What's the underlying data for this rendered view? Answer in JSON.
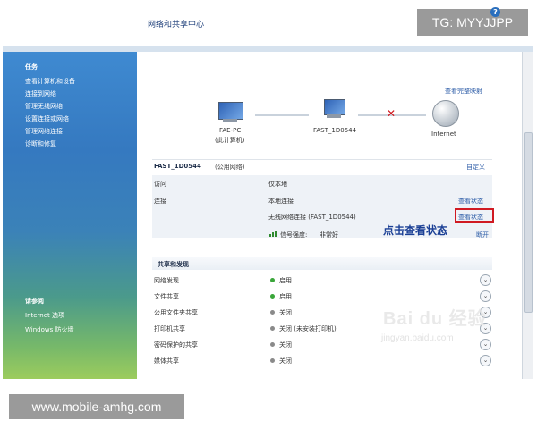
{
  "watermarks": {
    "top": "TG: MYYJJPP",
    "bottom": "www.mobile-amhg.com",
    "baidu": "Bai du 经验",
    "baidu_sub": "jingyan.baidu.com"
  },
  "window": {
    "title": "网络和共享中心"
  },
  "sidebar": {
    "tasks_heading": "任务",
    "items": [
      "查看计算机和设备",
      "连接到网络",
      "管理无线网络",
      "设置连接或网络",
      "管理网络连接",
      "诊断和修复"
    ],
    "see_also_heading": "请参阅",
    "see_also": [
      "Internet 选项",
      "Windows 防火墙"
    ]
  },
  "topology": {
    "view_full_map": "查看完整映射",
    "pc_name": "FAE-PC",
    "pc_caption": "(此计算机)",
    "router_name": "FAST_1D0544",
    "internet": "Internet"
  },
  "network": {
    "name": "FAST_1D0544",
    "type": "(公用网络)",
    "customize": "自定义",
    "access_label": "访问",
    "access_value": "仅本地",
    "connection_label": "连接",
    "connection_local": "本地连接",
    "connection_wireless": "无线网络连接 (FAST_1D0544)",
    "view_status_1": "查看状态",
    "view_status_2": "查看状态",
    "signal_label": "信号强度:",
    "signal_value": "非常好",
    "disconnect": "断开"
  },
  "annotation": "点击查看状态",
  "sharing": {
    "heading": "共享和发现",
    "rows": [
      {
        "label": "网络发现",
        "value": "启用",
        "status_color": "#3aa63a"
      },
      {
        "label": "文件共享",
        "value": "启用",
        "status_color": "#3aa63a"
      },
      {
        "label": "公用文件夹共享",
        "value": "关闭",
        "status_color": "#8a8a8a"
      },
      {
        "label": "打印机共享",
        "value": "关闭 (未安装打印机)",
        "status_color": "#8a8a8a"
      },
      {
        "label": "密码保护的共享",
        "value": "关闭",
        "status_color": "#8a8a8a"
      },
      {
        "label": "媒体共享",
        "value": "关闭",
        "status_color": "#8a8a8a"
      }
    ]
  },
  "icons": {
    "help": "?",
    "expand": "⌄",
    "close_x": "✕"
  },
  "colors": {
    "sidebar_blue": "#3579c0",
    "link": "#2f5ea8",
    "highlight_red": "#d01a22",
    "annotation_blue": "#1a3f95"
  }
}
